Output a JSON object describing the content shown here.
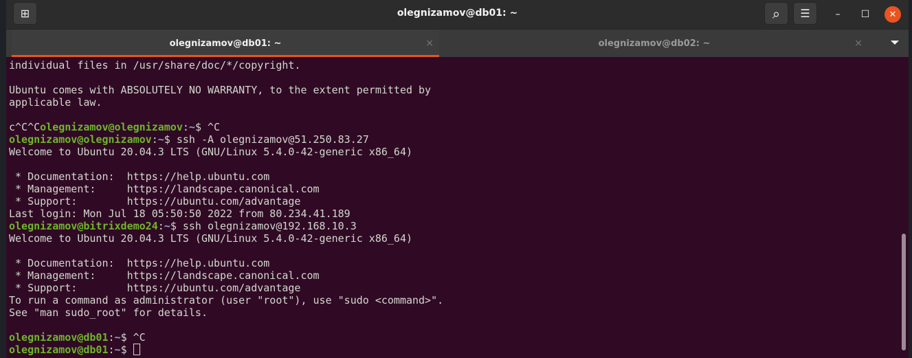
{
  "window": {
    "title": "olegnizamov@db01: ~"
  },
  "tabs": [
    {
      "label": "olegnizamov@db01: ~",
      "active": true
    },
    {
      "label": "olegnizamov@db02: ~",
      "active": false
    }
  ],
  "icons": {
    "new_tab": "new-tab-icon",
    "search": "search-icon",
    "menu": "hamburger-menu-icon",
    "minimize": "minimize-icon",
    "maximize": "maximize-icon",
    "close": "close-icon"
  },
  "glyphs": {
    "new_tab": "⊞",
    "search": "⌕",
    "menu": "☰",
    "min": "–",
    "max": "☐",
    "close": "✕",
    "tab_close": "×"
  },
  "colors": {
    "background": "#300a24",
    "prompt_user": "#6fb52a",
    "prompt_path": "#8aa4c8",
    "accent": "#e95420"
  },
  "terminal": {
    "lines": [
      {
        "text": "individual files in /usr/share/doc/*/copyright."
      },
      {
        "text": ""
      },
      {
        "text": "Ubuntu comes with ABSOLUTELY NO WARRANTY, to the extent permitted by"
      },
      {
        "text": "applicable law."
      },
      {
        "text": ""
      },
      {
        "pre": "c^C^C",
        "user": "olegnizamov@olegnizamov",
        "path": "~",
        "cmd": "$ ^C"
      },
      {
        "user": "olegnizamov@olegnizamov",
        "path": "~",
        "cmd": "$ ssh -A olegnizamov@51.250.83.27"
      },
      {
        "text": "Welcome to Ubuntu 20.04.3 LTS (GNU/Linux 5.4.0-42-generic x86_64)"
      },
      {
        "text": ""
      },
      {
        "text": " * Documentation:  https://help.ubuntu.com"
      },
      {
        "text": " * Management:     https://landscape.canonical.com"
      },
      {
        "text": " * Support:        https://ubuntu.com/advantage"
      },
      {
        "text": "Last login: Mon Jul 18 05:50:50 2022 from 80.234.41.189"
      },
      {
        "user": "olegnizamov@bitrixdemo24",
        "path": "~",
        "cmd": "$ ssh olegnizamov@192.168.10.3"
      },
      {
        "text": "Welcome to Ubuntu 20.04.3 LTS (GNU/Linux 5.4.0-42-generic x86_64)"
      },
      {
        "text": ""
      },
      {
        "text": " * Documentation:  https://help.ubuntu.com"
      },
      {
        "text": " * Management:     https://landscape.canonical.com"
      },
      {
        "text": " * Support:        https://ubuntu.com/advantage"
      },
      {
        "text": "To run a command as administrator (user \"root\"), use \"sudo <command>\"."
      },
      {
        "text": "See \"man sudo_root\" for details."
      },
      {
        "text": ""
      },
      {
        "user": "olegnizamov@db01",
        "path": "~",
        "cmd": "$ ^C"
      },
      {
        "user": "olegnizamov@db01",
        "path": "~",
        "cmd": "$ ",
        "cursor": true
      }
    ]
  }
}
